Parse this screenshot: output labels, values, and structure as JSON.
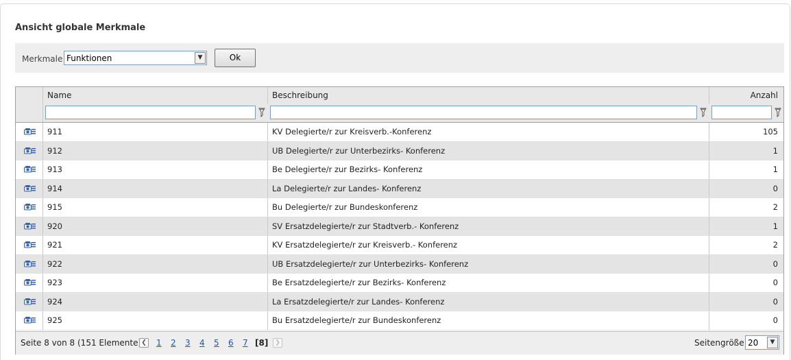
{
  "page": {
    "title": "Ansicht globale Merkmale"
  },
  "filter": {
    "label": "Merkmale",
    "select_value": "Funktionen",
    "ok_label": "Ok"
  },
  "grid": {
    "columns": [
      "Name",
      "Beschreibung",
      "Anzahl"
    ],
    "row_icon": "edit-record-icon",
    "filter_icon": "funnel-icon",
    "rows": [
      {
        "name": "911",
        "beschreibung": "KV Delegierte/r zur Kreisverb.-Konferenz",
        "anzahl": "105"
      },
      {
        "name": "912",
        "beschreibung": "UB Delegierte/r zur Unterbezirks- Konferenz",
        "anzahl": "1"
      },
      {
        "name": "913",
        "beschreibung": "Be Delegierte/r zur Bezirks- Konferenz",
        "anzahl": "1"
      },
      {
        "name": "914",
        "beschreibung": "La Delegierte/r zur Landes- Konferenz",
        "anzahl": "0"
      },
      {
        "name": "915",
        "beschreibung": "Bu Delegierte/r zur Bundeskonferenz",
        "anzahl": "2"
      },
      {
        "name": "920",
        "beschreibung": "SV Ersatzdelegierte/r zur Stadtverb.- Konferenz",
        "anzahl": "1"
      },
      {
        "name": "921",
        "beschreibung": "KV Ersatzdelegierte/r zur Kreisverb.- Konferenz",
        "anzahl": "2"
      },
      {
        "name": "922",
        "beschreibung": "UB Ersatzdelegierte/r zur Unterbezirks- Konferenz",
        "anzahl": "0"
      },
      {
        "name": "923",
        "beschreibung": "Be Ersatzdelegierte/r zur Bezirks- Konferenz",
        "anzahl": "0"
      },
      {
        "name": "924",
        "beschreibung": "La Ersatzdelegierte/r zur Landes- Konferenz",
        "anzahl": "0"
      },
      {
        "name": "925",
        "beschreibung": "Bu Ersatzdelegierte/r zur Bundeskonferenz",
        "anzahl": "0"
      }
    ]
  },
  "pager": {
    "info": "Seite 8 von 8 (151 Elemente)",
    "prev_icon": "chevron-left-icon",
    "next_icon": "chevron-right-icon",
    "pages": [
      "1",
      "2",
      "3",
      "4",
      "5",
      "6",
      "7"
    ],
    "current": "[8]",
    "size_label": "Seitengröße:",
    "size_value": "20"
  },
  "colors": {
    "link": "#1a56b0",
    "row_alt": "#e4e4e4",
    "header_bg": "#e8e8e8",
    "icon_blue": "#3a62a8"
  }
}
